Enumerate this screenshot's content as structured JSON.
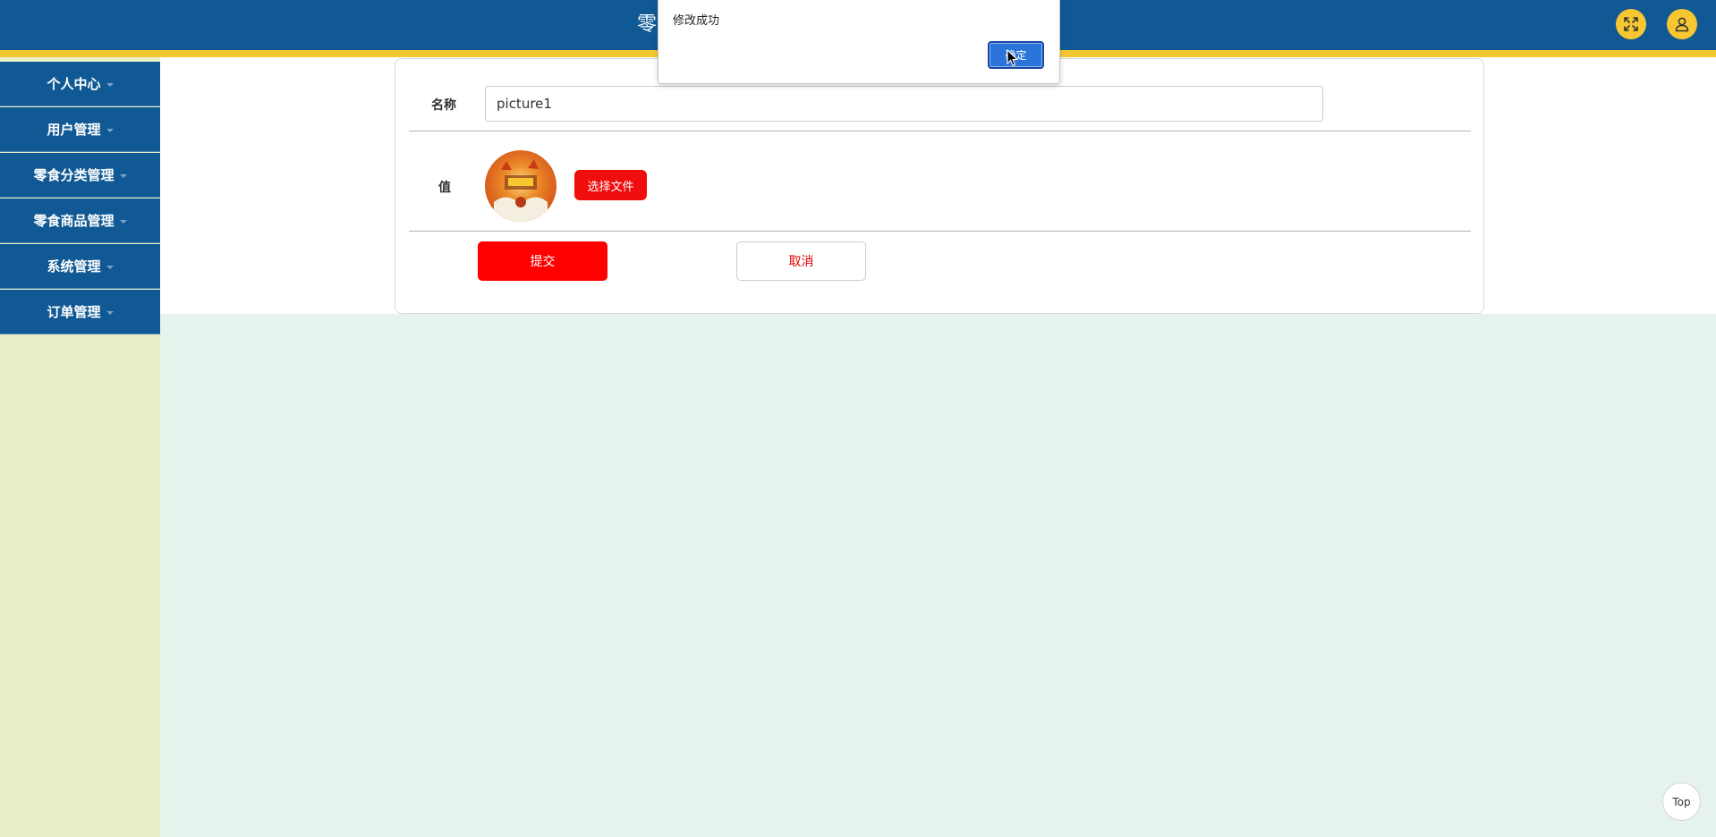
{
  "header": {
    "title_visible": "零",
    "fullscreen_icon": "fullscreen-icon",
    "user_icon": "user-icon",
    "accent": "#f6c731",
    "bg": "#115994"
  },
  "sidebar": {
    "items": [
      {
        "label": "个人中心"
      },
      {
        "label": "用户管理"
      },
      {
        "label": "零食分类管理"
      },
      {
        "label": "零食商品管理"
      },
      {
        "label": "系统管理"
      },
      {
        "label": "订单管理"
      }
    ]
  },
  "form": {
    "name_label": "名称",
    "name_value": "picture1",
    "value_label": "值",
    "choose_file_label": "选择文件",
    "submit_label": "提交",
    "cancel_label": "取消"
  },
  "dialog": {
    "message": "修改成功",
    "ok_label": "确定"
  },
  "footer": {
    "top_label": "Top"
  }
}
